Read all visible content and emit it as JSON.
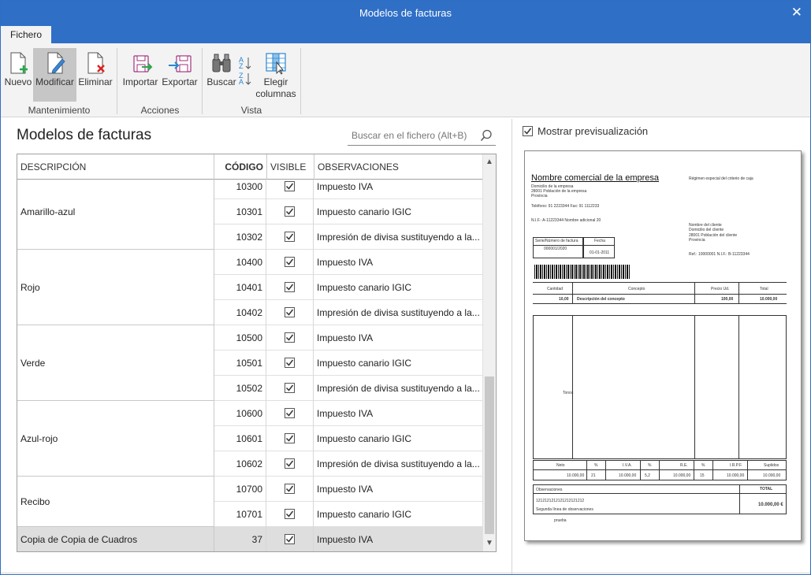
{
  "window": {
    "title": "Modelos de facturas"
  },
  "tabs": [
    {
      "label": "Fichero"
    }
  ],
  "ribbon": {
    "buttons": {
      "nuevo": "Nuevo",
      "modificar": "Modificar",
      "eliminar": "Eliminar",
      "importar": "Importar",
      "exportar": "Exportar",
      "buscar": "Buscar",
      "elegir1": "Elegir",
      "elegir2": "columnas"
    },
    "groups": {
      "mantenimiento": "Mantenimiento",
      "acciones": "Acciones",
      "vista": "Vista"
    }
  },
  "main": {
    "title": "Modelos de facturas",
    "search_placeholder": "Buscar en el fichero (Alt+B)"
  },
  "grid": {
    "headers": {
      "descripcion": "DESCRIPCIÓN",
      "codigo": "CÓDIGO",
      "visible": "VISIBLE",
      "observaciones": "OBSERVACIONES"
    },
    "groups": [
      {
        "desc": "Amarillo-azul",
        "rows": [
          {
            "code": "10300",
            "visible": true,
            "obs": "Impuesto IVA"
          },
          {
            "code": "10301",
            "visible": true,
            "obs": "Impuesto canario IGIC"
          },
          {
            "code": "10302",
            "visible": true,
            "obs": "Impresión de divisa sustituyendo a la..."
          }
        ]
      },
      {
        "desc": "Rojo",
        "rows": [
          {
            "code": "10400",
            "visible": true,
            "obs": "Impuesto IVA"
          },
          {
            "code": "10401",
            "visible": true,
            "obs": "Impuesto canario IGIC"
          },
          {
            "code": "10402",
            "visible": true,
            "obs": "Impresión de divisa sustituyendo a la..."
          }
        ]
      },
      {
        "desc": "Verde",
        "rows": [
          {
            "code": "10500",
            "visible": true,
            "obs": "Impuesto IVA"
          },
          {
            "code": "10501",
            "visible": true,
            "obs": "Impuesto canario IGIC"
          },
          {
            "code": "10502",
            "visible": true,
            "obs": "Impresión de divisa sustituyendo a la..."
          }
        ]
      },
      {
        "desc": "Azul-rojo",
        "rows": [
          {
            "code": "10600",
            "visible": true,
            "obs": "Impuesto IVA"
          },
          {
            "code": "10601",
            "visible": true,
            "obs": "Impuesto canario IGIC"
          },
          {
            "code": "10602",
            "visible": true,
            "obs": "Impresión de divisa sustituyendo a la..."
          }
        ]
      },
      {
        "desc": "Recibo",
        "rows": [
          {
            "code": "10700",
            "visible": true,
            "obs": "Impuesto IVA"
          },
          {
            "code": "10701",
            "visible": true,
            "obs": "Impuesto canario IGIC"
          }
        ]
      },
      {
        "desc": "Copia de Copia de Cuadros",
        "selected": true,
        "rows": [
          {
            "code": "37",
            "visible": true,
            "obs": "Impuesto IVA"
          }
        ]
      }
    ]
  },
  "preview": {
    "checkbox_label": "Mostrar previsualización",
    "checked": true,
    "company_name": "Nombre comercial de la empresa",
    "regime": "Régimen especial del criterio de caja",
    "company_address": "Domicilio de la empresa",
    "company_city": "28001     Población de la empresa",
    "company_province": "Provincia",
    "company_phone": "Teléfono: 91 2223344  Fax:  91 1112233",
    "company_nif": "N.I.F.:    A-11223344 Nombre adicional 20",
    "client_name": "Nombre del cliente",
    "client_address": "Domicilio del cliente",
    "client_city": "28001 Población del cliente",
    "client_province": "Provincia",
    "client_ref": "Ref.:  10000001        N.I.F.:    B-11223344",
    "serie_label": "Serie/Número de factura",
    "serie_value": "000001/2020",
    "fecha_label": "Fecha",
    "fecha_value": "01-01-2011",
    "col_cantidad": "Cantidad",
    "col_concepto": "Concepto",
    "col_precio": "Precio Ud.",
    "col_total": "Total",
    "line_cantidad": "10,00",
    "line_desc": "Descripción del concepto",
    "line_precio": "100,00",
    "line_total": "10.000,00",
    "tonos": "Tonos",
    "tot_neto": "Neto",
    "tot_pct": "%",
    "tot_iva": "I.V.A.",
    "tot_re": "R.E.",
    "tot_irpf": "I.R.P.F.",
    "tot_suplidos": "Suplidos",
    "val_neto": "10.000,00",
    "val_pct_iva": "21",
    "val_iva": "10.000,00",
    "val_pct_re": "5,2",
    "val_re": "10.000,00",
    "val_pct_irpf": "15",
    "val_irpf": "10.000,00",
    "val_suplidos": "10.000,00",
    "observaciones": "Observaciones",
    "total_label": "TOTAL",
    "obs_line": "1212121212121212121212",
    "total_value": "10.000,00 €",
    "obs_second": "Segunda línea de observaciones",
    "prueba": "prueba"
  }
}
